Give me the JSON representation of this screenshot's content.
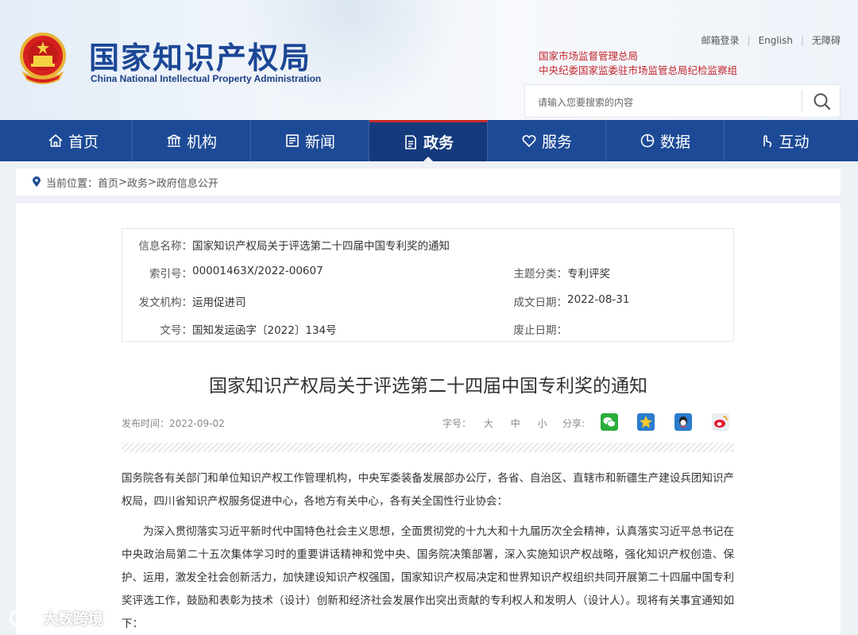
{
  "header": {
    "title": "国家知识产权局",
    "subtitle": "China National Intellectual Property Administration",
    "top_links": [
      "邮箱登录",
      "English",
      "无障碍"
    ],
    "related_links": [
      "国家市场监督管理总局",
      "中央纪委国家监委驻市场监管总局纪检监察组"
    ],
    "search_placeholder": "请输入您要搜索的内容"
  },
  "nav": {
    "items": [
      {
        "label": "首页",
        "icon": "home-icon"
      },
      {
        "label": "机构",
        "icon": "institution-icon"
      },
      {
        "label": "新闻",
        "icon": "news-icon"
      },
      {
        "label": "政务",
        "icon": "government-affairs-icon",
        "active": true
      },
      {
        "label": "服务",
        "icon": "service-icon"
      },
      {
        "label": "数据",
        "icon": "data-icon"
      },
      {
        "label": "互动",
        "icon": "interaction-icon"
      }
    ]
  },
  "breadcrumb": {
    "prefix": "当前位置：",
    "path": [
      "首页",
      "政务",
      "政府信息公开"
    ],
    "sep": ">"
  },
  "meta": {
    "name_label": "信息名称：",
    "name": "国家知识产权局关于评选第二十四届中国专利奖的通知",
    "index_label": "索引号：",
    "index": "00001463X/2022-00607",
    "category_label": "主题分类：",
    "category": "专利评奖",
    "issuer_label": "发文机构：",
    "issuer": "运用促进司",
    "created_label": "成文日期：",
    "created": "2022-08-31",
    "doc_no_label": "文号：",
    "doc_no": "国知发运函字〔2022〕134号",
    "expire_label": "废止日期：",
    "expire": ""
  },
  "article": {
    "title": "国家知识产权局关于评选第二十四届中国专利奖的通知",
    "publish_time": "发布时间：2022-09-02",
    "font_size_label": "字号：",
    "font_sizes": [
      "大",
      "中",
      "小"
    ],
    "share_label": "分享:",
    "share_targets": [
      "wechat-icon",
      "qzone-icon",
      "qq-icon",
      "weibo-icon"
    ],
    "paragraphs": [
      "国务院各有关部门和单位知识产权工作管理机构，中央军委装备发展部办公厅，各省、自治区、直辖市和新疆生产建设兵团知识产权局，四川省知识产权服务促进中心，各地方有关中心，各有关全国性行业协会：",
      "为深入贯彻落实习近平新时代中国特色社会主义思想，全面贯彻党的十九大和十九届历次全会精神，认真落实习近平总书记在中央政治局第二十五次集体学习时的重要讲话精神和党中央、国务院决策部署，深入实施知识产权战略，强化知识产权创造、保护、运用，激发全社会创新活力，加快建设知识产权强国，国家知识产权局决定和世界知识产权组织共同开展第二十四届中国专利奖评选工作，鼓励和表彰为技术（设计）创新和经济社会发展作出突出贡献的专利权人和发明人（设计人）。现将有关事宜通知如下："
    ]
  },
  "watermark": "大数跨境",
  "colors": {
    "brand_blue": "#1d4a96",
    "active_nav": "#143a7d",
    "accent_red": "#c0262c"
  }
}
